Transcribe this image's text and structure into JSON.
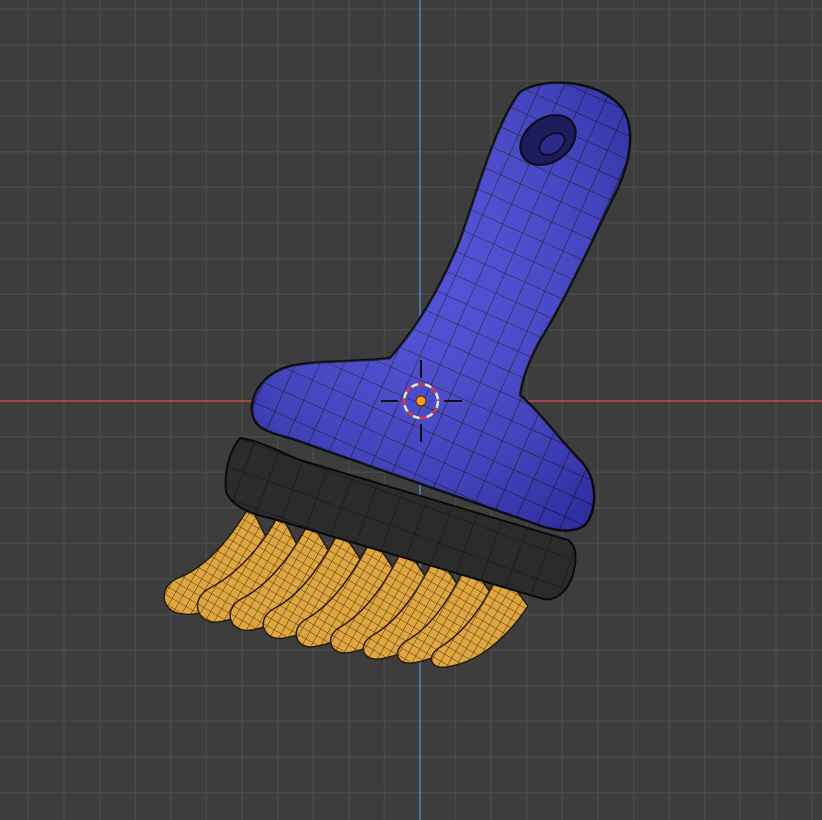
{
  "viewport": {
    "background": "#3d3d3d",
    "grid_minor_color": "#4a4a4a",
    "grid_major_color": "#525252",
    "axis_x_color": "#c04a55",
    "axis_y_color": "#4a84c4"
  },
  "model": {
    "handle_color": "#3f3fd6",
    "ferrule_color": "#2b2b2b",
    "bristle_color": "#e0a640",
    "wire_color": "#0d0d14"
  },
  "origin": {
    "icon": "3d-cursor-icon",
    "cursor_ring_colors": [
      "#e6e6e6",
      "#d23c3c"
    ],
    "origin_dot_color": "#ff9b1a"
  }
}
